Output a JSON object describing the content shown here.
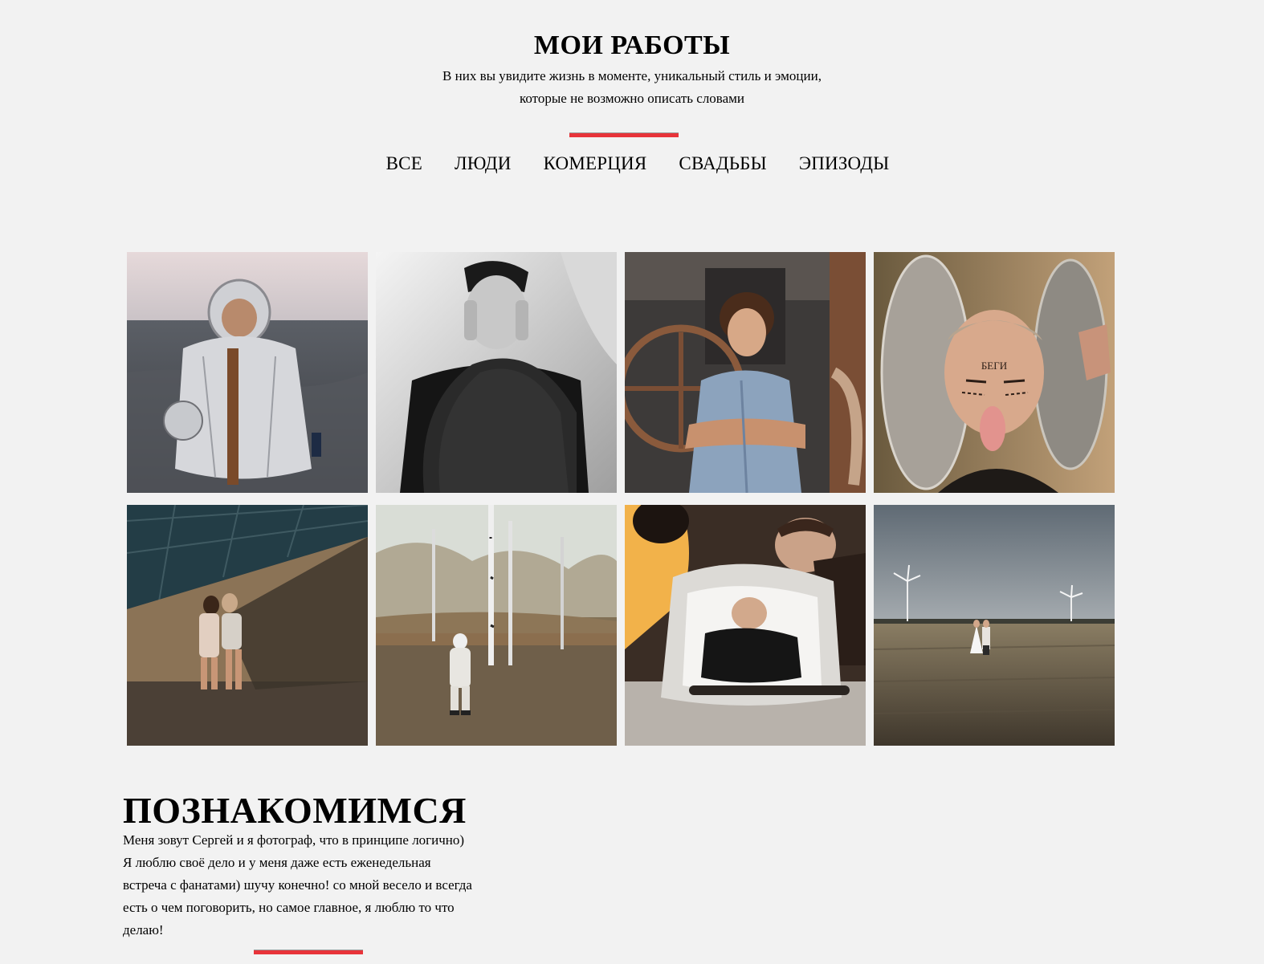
{
  "works": {
    "title": "МОИ РАБОТЫ",
    "subtitle_line1": "В них вы увидите жизнь в моменте, уникальный стиль и эмоции,",
    "subtitle_line2": "которые не возможно описать словами"
  },
  "filters": [
    {
      "label": "ВСЕ"
    },
    {
      "label": "ЛЮДИ"
    },
    {
      "label": "КОМЕРЦИЯ"
    },
    {
      "label": "СВАДЬБЫ"
    },
    {
      "label": "ЭПИЗОДЫ"
    }
  ],
  "gallery": {
    "photo_4_text": "БЕГИ"
  },
  "about": {
    "title": "ПОЗНАКОМИМСЯ",
    "line1": "Меня зовут Сергей и я фотограф, что в принципе логично)",
    "line2": "Я люблю своё дело и у меня даже есть еженедельная",
    "line3": "встреча с фанатами) шучу конечно! со мной весело и всегда",
    "line4": "есть о чем поговорить, но самое главное, я люблю то что",
    "line5": "делаю!"
  },
  "colors": {
    "background": "#f2f2f2",
    "accent": "#e8343a"
  }
}
